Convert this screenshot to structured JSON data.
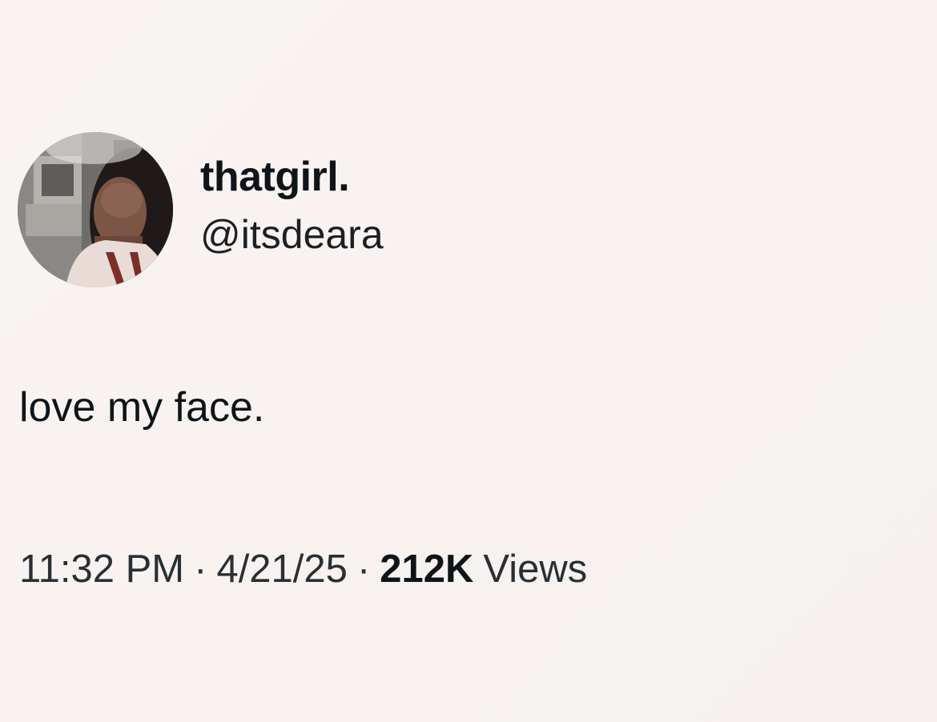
{
  "author": {
    "display_name": "thatgirl.",
    "handle": "@itsdeara"
  },
  "tweet": {
    "text": "love my face.",
    "time": "11:32 PM",
    "separator": "·",
    "date": "4/21/25",
    "views_count": "212K",
    "views_label": "Views"
  },
  "colors": {
    "background": "#f8f3f1",
    "text_primary": "#0f1419",
    "text_secondary": "#2a2f34"
  }
}
